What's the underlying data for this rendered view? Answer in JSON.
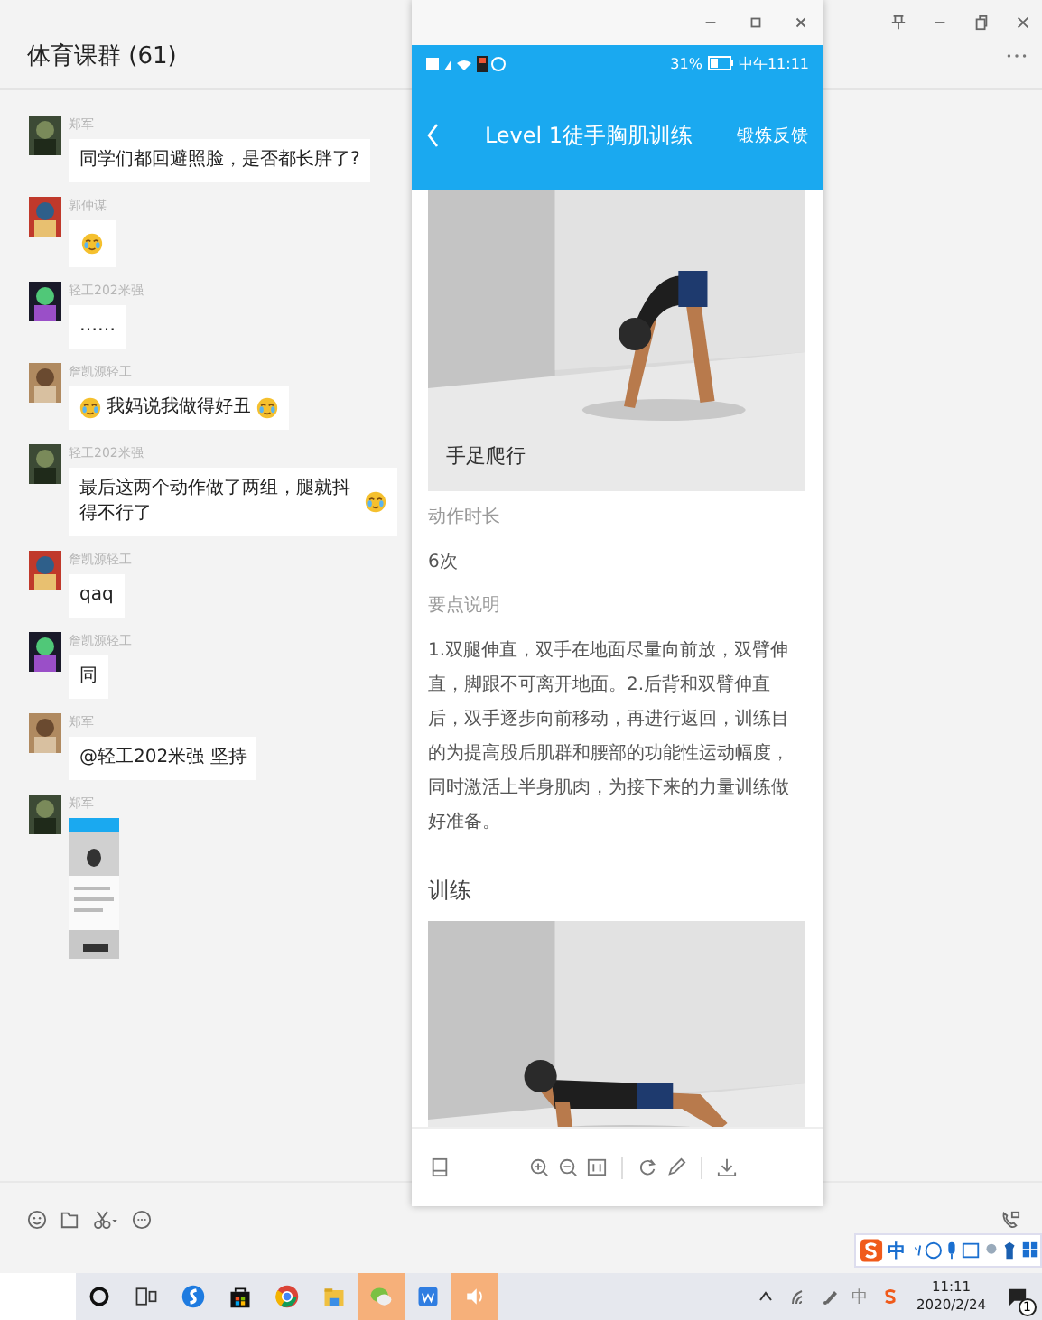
{
  "chat": {
    "title": "体育课群 (61)",
    "messages": [
      {
        "sender": "郑军",
        "kind": "text",
        "text": "同学们都回避照脸，是否都长胖了?",
        "emoji_before": false,
        "emoji_after": false
      },
      {
        "sender": "郭仲谋",
        "kind": "emoji"
      },
      {
        "sender": "轻工202米强",
        "kind": "text",
        "text": "……",
        "emoji_before": false,
        "emoji_after": false
      },
      {
        "sender": "詹凯源轻工",
        "kind": "text",
        "text": "我妈说我做得好丑",
        "emoji_before": true,
        "emoji_after": true
      },
      {
        "sender": "轻工202米强",
        "kind": "text",
        "text": "最后这两个动作做了两组，腿就抖得不行了",
        "emoji_before": false,
        "emoji_after": true
      },
      {
        "sender": "詹凯源轻工",
        "kind": "text",
        "text": "qaq",
        "emoji_before": false,
        "emoji_after": false
      },
      {
        "sender": "詹凯源轻工",
        "kind": "text",
        "text": "同",
        "emoji_before": false,
        "emoji_after": false
      },
      {
        "sender": "郑军",
        "kind": "text",
        "text": "@轻工202米强 坚持",
        "emoji_before": false,
        "emoji_after": false
      },
      {
        "sender": "郑军"
      }
    ]
  },
  "viewer": {
    "status": {
      "battery": "31%",
      "time": "中午11:11"
    },
    "title": "Level 1徒手胸肌训练",
    "action": "锻炼反馈",
    "caption": "手足爬行",
    "fields": [
      {
        "label": "动作时长",
        "value": "6次"
      },
      {
        "label": "要点说明",
        "value": "1.双腿伸直，双手在地面尽量向前放，双臂伸直，脚跟不可离开地面。2.后背和双臂伸直后，双手逐步向前移动，再进行返回，训练目的为提高股后肌群和腰部的功能性运动幅度，同时激活上半身肌肉，为接下来的力量训练做好准备。"
      }
    ],
    "section": "训练"
  },
  "ime": {
    "mode": "中"
  },
  "taskbar": {
    "apps": [
      {
        "kind": "search",
        "highlighted": false
      },
      {
        "kind": "taskview",
        "highlighted": false
      },
      {
        "kind": "browser",
        "highlighted": false
      },
      {
        "kind": "store",
        "highlighted": false
      },
      {
        "kind": "globe",
        "highlighted": false
      },
      {
        "kind": "folder",
        "highlighted": false
      },
      {
        "kind": "chat",
        "highlighted": true
      },
      {
        "kind": "document",
        "highlighted": false
      },
      {
        "kind": "speaker",
        "highlighted": true
      }
    ],
    "tray_input": "中",
    "time": "11:11",
    "date": "2020/2/24",
    "notifications": "1"
  }
}
